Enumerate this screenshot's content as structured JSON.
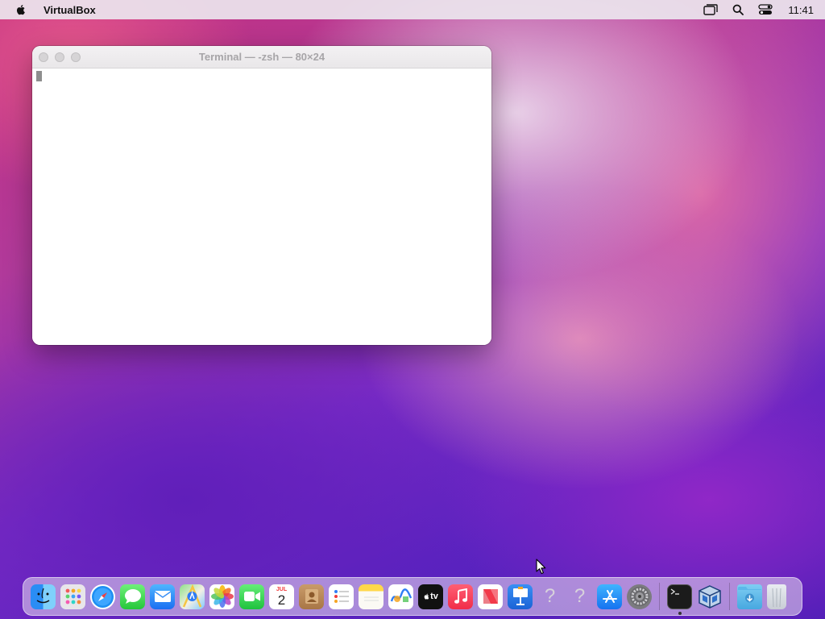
{
  "menubar": {
    "app_name": "VirtualBox",
    "clock": "11:41",
    "icons": [
      "apple-icon",
      "display-mirroring-icon",
      "spotlight-search-icon",
      "control-center-icon"
    ]
  },
  "terminal_window": {
    "title": "Terminal — -zsh — 80×24",
    "buttons": [
      "close",
      "minimize",
      "zoom"
    ],
    "active": false
  },
  "dock": {
    "calendar": {
      "month": "JUL",
      "day": "2"
    },
    "tv_label": "tv",
    "unknown_glyph": "?",
    "apps": [
      "finder",
      "launchpad",
      "safari",
      "messages",
      "mail",
      "maps",
      "photos",
      "facetime",
      "calendar",
      "contacts",
      "reminders",
      "notes",
      "freeform",
      "apple-tv",
      "music",
      "news",
      "keynote",
      "unknown-app",
      "unknown-app",
      "app-store",
      "system-settings",
      "terminal",
      "virtualbox",
      "downloads",
      "trash"
    ],
    "running": [
      "terminal"
    ]
  },
  "colors": {
    "menubar_bg": "#ece6ee",
    "window_bg": "#ffffff",
    "title_inactive": "#a7a5a8",
    "cursor": "#8e8e8e"
  }
}
